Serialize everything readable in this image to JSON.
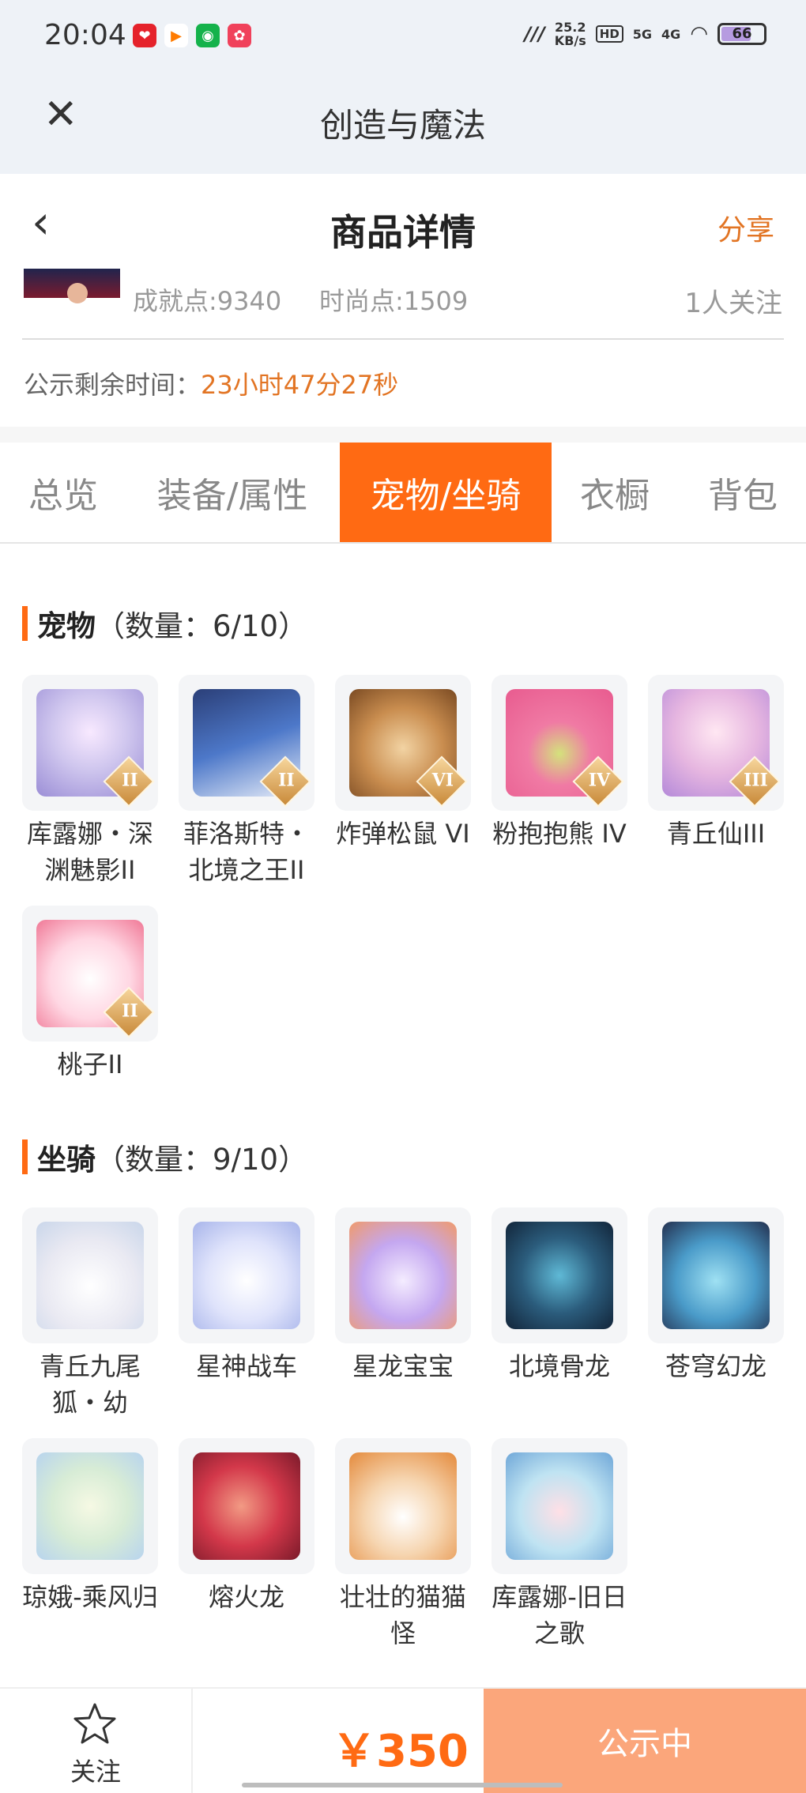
{
  "status_bar": {
    "time": "20:04",
    "speed_value": "25.2",
    "speed_unit": "KB/s",
    "hd": "HD",
    "net_5g": "5G",
    "net_4g": "4G",
    "battery": "66"
  },
  "app_header": {
    "title": "创造与魔法",
    "close_icon": "close-icon"
  },
  "page_header": {
    "title": "商品详情",
    "share": "分享",
    "back_icon": "chevron-left-icon"
  },
  "info": {
    "achievement": "成就点:9340",
    "fashion": "时尚点:1509",
    "watchers": "1人关注",
    "countdown_label": "公示剩余时间：",
    "countdown_value": "23小时47分27秒"
  },
  "tabs": [
    {
      "label": "总览",
      "active": false
    },
    {
      "label": "装备/属性",
      "active": false
    },
    {
      "label": "宠物/坐骑",
      "active": true
    },
    {
      "label": "衣橱",
      "active": false
    },
    {
      "label": "背包",
      "active": false
    }
  ],
  "pets": {
    "title": "宠物",
    "count": "（数量：6/10）",
    "items": [
      {
        "name": "库露娜・深渊魅影II",
        "badge": "II"
      },
      {
        "name": "菲洛斯特・北境之王II",
        "badge": "II"
      },
      {
        "name": "炸弹松鼠 VI",
        "badge": "VI"
      },
      {
        "name": "粉抱抱熊 IV",
        "badge": "IV"
      },
      {
        "name": "青丘仙III",
        "badge": "III"
      },
      {
        "name": "桃子II",
        "badge": "II"
      }
    ]
  },
  "mounts": {
    "title": "坐骑",
    "count": "（数量：9/10）",
    "items": [
      {
        "name": "青丘九尾狐・幼"
      },
      {
        "name": "星神战车"
      },
      {
        "name": "星龙宝宝"
      },
      {
        "name": "北境骨龙"
      },
      {
        "name": "苍穹幻龙"
      },
      {
        "name": "琼娥-乘风归"
      },
      {
        "name": "熔火龙"
      },
      {
        "name": "壮壮的猫猫怪"
      },
      {
        "name": "库露娜-旧日之歌"
      }
    ]
  },
  "bottom_bar": {
    "follow_label": "关注",
    "price": "￥350",
    "status": "公示中"
  },
  "colors": {
    "accent": "#ff6a13",
    "highlight_text": "#e27423",
    "status_button": "#fba67b"
  }
}
